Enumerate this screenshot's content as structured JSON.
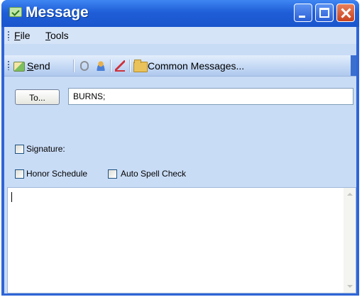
{
  "window": {
    "title": "Message",
    "controls": [
      "minimize",
      "maximize",
      "close"
    ]
  },
  "menubar": {
    "items": [
      {
        "label": "File",
        "accel": "F",
        "rest": "ile"
      },
      {
        "label": "Tools",
        "accel": "T",
        "rest": "ools"
      }
    ]
  },
  "toolbar": {
    "send": {
      "accel": "S",
      "rest": "end"
    },
    "common_messages": "Common Messages...",
    "icons": [
      "send-icon",
      "paperclip-icon",
      "address-book-icon",
      "spell-check-icon",
      "folder-icon"
    ]
  },
  "compose": {
    "to_button": "To...",
    "to_value": "BURNS;",
    "signature_label": "Signature:",
    "honor_schedule_label": "Honor Schedule",
    "auto_spell_check_label": "Auto Spell Check",
    "body_text": ""
  },
  "colors": {
    "titlebar": "#1f5ed8",
    "client": "#c9dcf6",
    "close_button": "#c8421e"
  }
}
